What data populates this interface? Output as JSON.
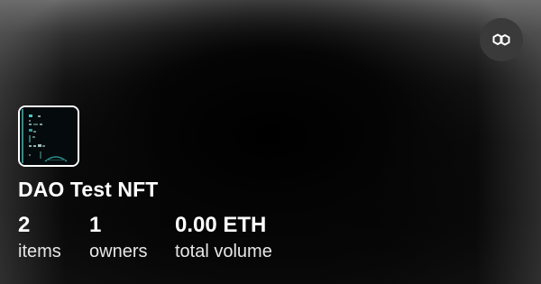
{
  "collection": {
    "name": "DAO Test NFT",
    "chain_icon": "polygon-icon"
  },
  "stats": [
    {
      "value": "2",
      "label": "items"
    },
    {
      "value": "1",
      "label": "owners"
    },
    {
      "value": "0.00 ETH",
      "label": "total volume"
    }
  ],
  "colors": {
    "background": "#050505",
    "text": "#ffffff",
    "badge": "#3a3a3a"
  }
}
